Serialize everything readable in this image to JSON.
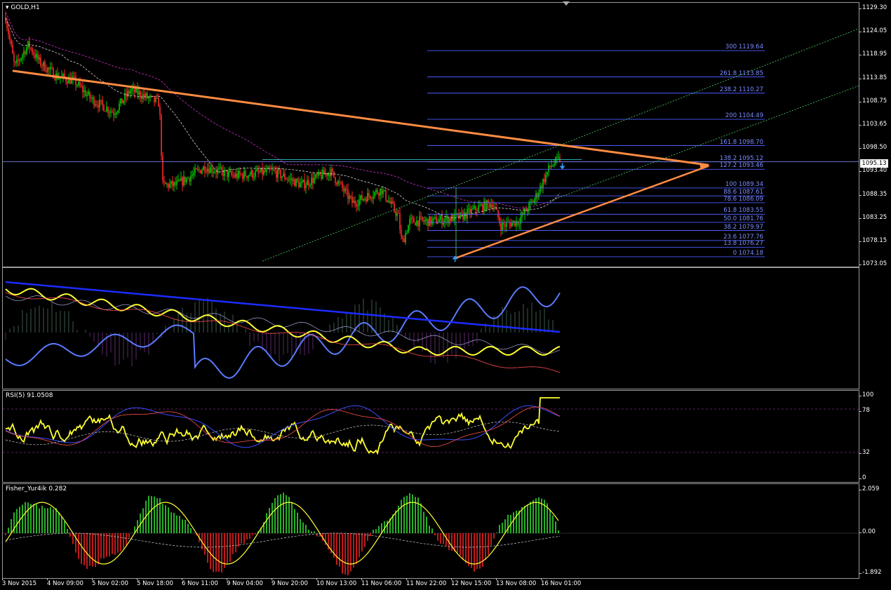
{
  "chart_label": "GOLD,H1",
  "current_price": "1095.13",
  "price_axis": [
    "1129.30",
    "1124.05",
    "1118.95",
    "1113.85",
    "1108.75",
    "1103.65",
    "1098.50",
    "1093.40",
    "1088.35",
    "1083.25",
    "1078.15",
    "1073.05"
  ],
  "fib_levels": [
    {
      "label": "300 1119.64"
    },
    {
      "label": "261.8 1113.85"
    },
    {
      "label": "238.2 1110.27"
    },
    {
      "label": "200 1104.49"
    },
    {
      "label": "161.8 1098.70"
    },
    {
      "label": "138.2 1095.12"
    },
    {
      "label": "127.2 1093.46"
    },
    {
      "label": "100 1089.34"
    },
    {
      "label": "88.6 1087.61"
    },
    {
      "label": "78.6 1086.09"
    },
    {
      "label": "61.8 1083.55"
    },
    {
      "label": "50.0 1081.76"
    },
    {
      "label": "38.2 1079.97"
    },
    {
      "label": "23.6 1077.76"
    },
    {
      "label": "13.8 1076.27"
    },
    {
      "label": "0 1074.18"
    }
  ],
  "rsi": {
    "label": "RSI(5) 91.0508",
    "axis": [
      "100",
      "78",
      "32",
      "0"
    ]
  },
  "fisher": {
    "label": "Fisher_Yur4ik 0.282",
    "axis": [
      "2.059",
      "0.00",
      "-1.892"
    ]
  },
  "time_axis": [
    "3 Nov 2015",
    "4 Nov 09:00",
    "5 Nov 02:00",
    "5 Nov 18:00",
    "6 Nov 11:00",
    "9 Nov 04:00",
    "9 Nov 20:00",
    "10 Nov 13:00",
    "11 Nov 06:00",
    "11 Nov 22:00",
    "12 Nov 15:00",
    "13 Nov 08:00",
    "16 Nov 01:00"
  ],
  "icons": {
    "menu": "triangle-down-icon",
    "scroll": "shift-marker-icon",
    "buy": "arrow-up-icon",
    "sell": "arrow-down-icon"
  },
  "colors": {
    "bull": "#00cc00",
    "bear": "#ff2a2a",
    "fib": "#4c5cff",
    "trend": "#ff8c42",
    "rsi": "#ffff33"
  }
}
